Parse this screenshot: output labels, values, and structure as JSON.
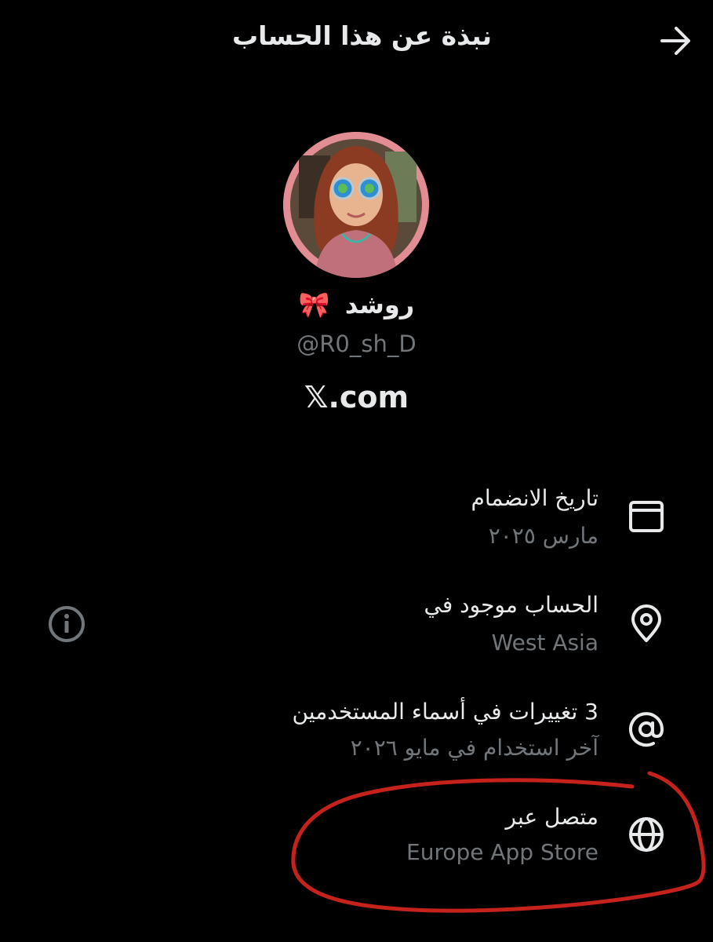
{
  "header": {
    "title": "نبذة عن هذا الحساب"
  },
  "profile": {
    "display_name": "روشد",
    "ribbon_emoji": "🎀",
    "handle": "@R0_sh_D",
    "platform": "𝕏.com"
  },
  "details": [
    {
      "icon": "calendar-icon",
      "title": "تاريخ الانضمام",
      "subtitle": "مارس ٢٠٢٥"
    },
    {
      "icon": "location-pin-icon",
      "title": "الحساب موجود في",
      "subtitle": "West Asia"
    },
    {
      "icon": "at-sign-icon",
      "title": "3 تغييرات في أسماء المستخدمين",
      "subtitle": "آخر استخدام في مايو ٢٠٢٦"
    },
    {
      "icon": "globe-icon",
      "title": "متصل عبر",
      "subtitle": "Europe App Store"
    }
  ],
  "colors": {
    "background": "#000000",
    "primary_text": "#e7e9ea",
    "secondary_text": "#71767b",
    "annotation_red": "#c4221a",
    "avatar_ring": "#e28d94"
  }
}
